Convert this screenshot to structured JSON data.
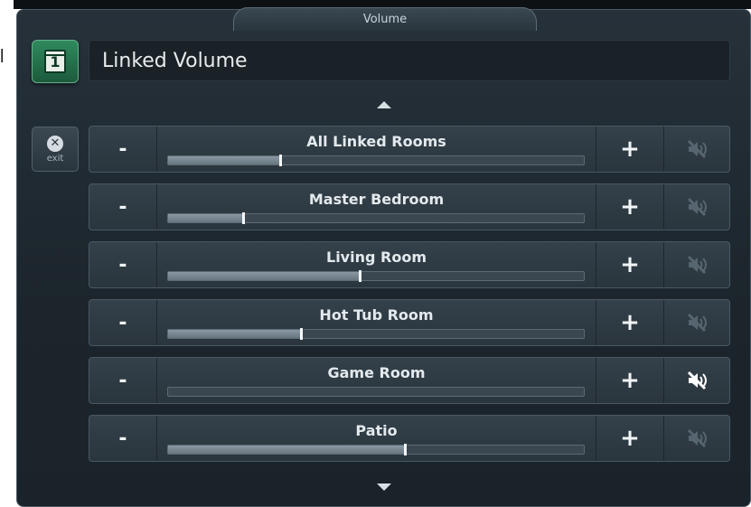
{
  "window": {
    "tab_title": "Volume"
  },
  "header": {
    "number_icon_text": "1",
    "title": "Linked Volume"
  },
  "controls": {
    "exit_label": "exit",
    "minus_label": "-",
    "plus_label": "+"
  },
  "rooms": [
    {
      "name": "All Linked Rooms",
      "level": 0.27,
      "muted": false
    },
    {
      "name": "Master Bedroom",
      "level": 0.18,
      "muted": false
    },
    {
      "name": "Living Room",
      "level": 0.46,
      "muted": false
    },
    {
      "name": "Hot Tub Room",
      "level": 0.32,
      "muted": false
    },
    {
      "name": "Game Room",
      "level": 0.0,
      "muted": true
    },
    {
      "name": "Patio",
      "level": 0.57,
      "muted": false
    }
  ],
  "colors": {
    "mute_active": "#ffffff",
    "mute_inactive": "#56656f"
  },
  "icons": {
    "exit": "close-circle-icon",
    "mute": "speaker-mute-icon",
    "scroll_up": "arrow-up-icon",
    "scroll_down": "arrow-down-icon",
    "number": "calendar-number-icon"
  }
}
